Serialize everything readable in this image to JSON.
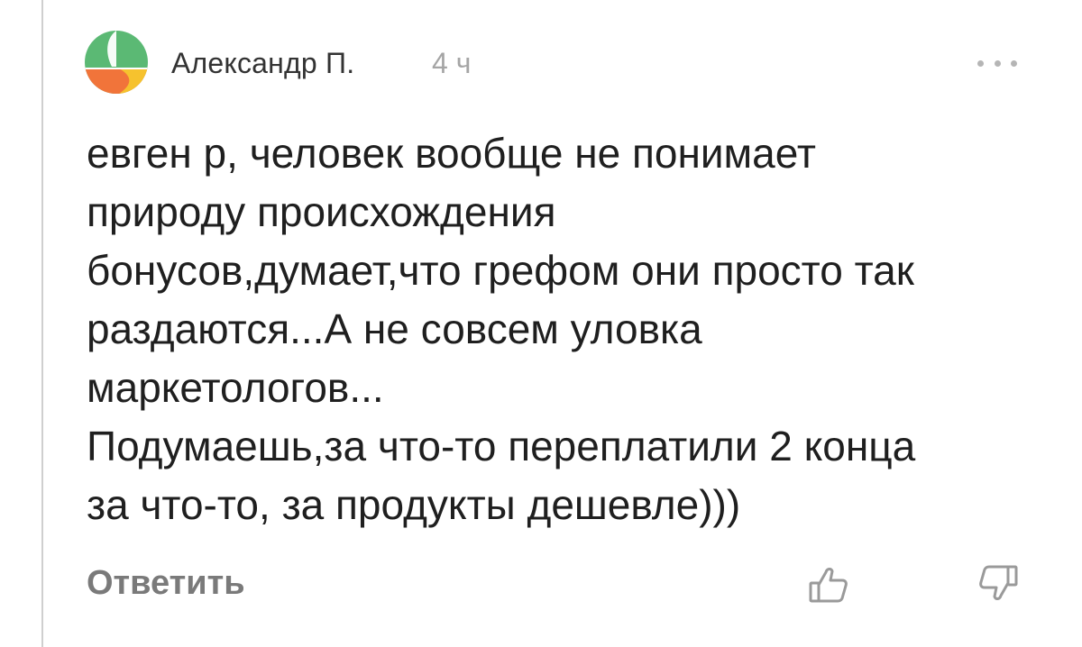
{
  "comment": {
    "author": "Александр П.",
    "time": "4 ч",
    "lines": [
      "евген р, человек вообще не понимает",
      "природу происхождения",
      "бонусов,думает,что грефом они просто так",
      "раздаются...А не совсем уловка",
      "маркетологов...",
      "Подумаешь,за что-то переплатили 2 конца",
      "за что-то, за продукты дешевле)))"
    ]
  },
  "actions": {
    "reply_label": "Ответить",
    "like_icon": "thumbs-up-icon",
    "dislike_icon": "thumbs-down-icon",
    "more_icon": "more-dots-icon"
  },
  "colors": {
    "avatar_green": "#5BB974",
    "avatar_orange": "#F1743A",
    "avatar_yellow": "#F6C22E",
    "thread_line": "#cfcfcf"
  }
}
